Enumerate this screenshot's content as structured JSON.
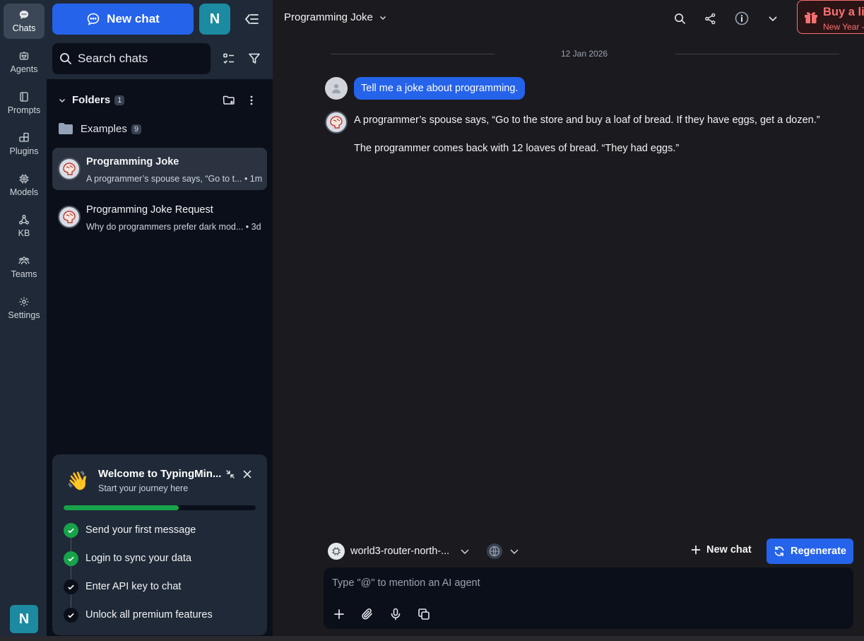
{
  "rail": {
    "items": [
      {
        "label": "Chats",
        "icon": "chat-bubble-icon",
        "active": true
      },
      {
        "label": "Agents",
        "icon": "agents-icon"
      },
      {
        "label": "Prompts",
        "icon": "book-icon"
      },
      {
        "label": "Plugins",
        "icon": "puzzle-icon"
      },
      {
        "label": "Models",
        "icon": "chip-icon"
      },
      {
        "label": "KB",
        "icon": "knowledge-icon"
      },
      {
        "label": "Teams",
        "icon": "team-icon"
      },
      {
        "label": "Settings",
        "icon": "gear-icon"
      }
    ],
    "avatar_letter": "N"
  },
  "sidebar": {
    "new_chat_label": "New chat",
    "avatar_letter": "N",
    "search_placeholder": "Search chats",
    "folders_label": "Folders",
    "folders_count": "1",
    "examples_label": "Examples",
    "examples_count": "9",
    "chats": [
      {
        "title": "Programming Joke",
        "preview": "A programmer’s spouse says, “Go to t...",
        "time": "• 1m",
        "active": true
      },
      {
        "title": "Programming Joke Request",
        "preview": "Why do programmers prefer dark mod...",
        "time": "• 3d",
        "active": false
      }
    ],
    "welcome": {
      "title": "Welcome to TypingMin...",
      "subtitle": "Start your journey here",
      "progress_fraction": 0.6,
      "steps": [
        {
          "label": "Send your first message",
          "done": true
        },
        {
          "label": "Login to sync your data",
          "done": true
        },
        {
          "label": "Enter API key to chat",
          "done": false
        },
        {
          "label": "Unlock all premium features",
          "done": false
        }
      ]
    }
  },
  "header": {
    "title": "Programming Joke",
    "promo_title": "Buy a li",
    "promo_sub": "New Year -"
  },
  "conversation": {
    "date": "12 Jan 2026",
    "user_message": "Tell me a joke about programming.",
    "ai_lines": [
      "A programmer’s spouse says, “Go to the store and buy a loaf of bread. If they have eggs, get a dozen.”",
      "The programmer comes back with 12 loaves of bread. “They had eggs.”"
    ]
  },
  "composer": {
    "model_name": "world3-router-north-...",
    "new_chat_label": "New chat",
    "regenerate_label": "Regenerate",
    "placeholder": "Type \"@\" to mention an AI agent"
  },
  "colors": {
    "accent": "#2563eb",
    "success": "#16a34a",
    "promo": "#f87171",
    "avatar": "#1c8aa0"
  }
}
